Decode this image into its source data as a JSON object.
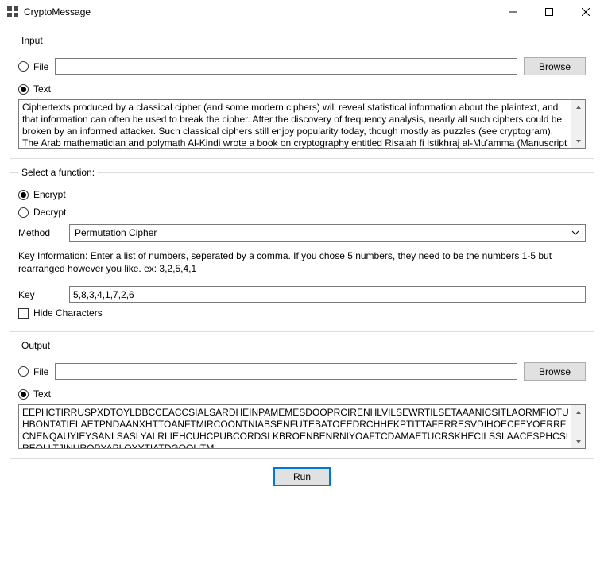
{
  "window": {
    "title": "CryptoMessage"
  },
  "input": {
    "legend": "Input",
    "file_label": "File",
    "file_value": "",
    "browse_label": "Browse",
    "text_label": "Text",
    "text_value": "Ciphertexts produced by a classical cipher (and some modern ciphers) will reveal statistical information about the plaintext, and that information can often be used to break the cipher. After the discovery of frequency analysis, nearly all such ciphers could be broken by an informed attacker. Such classical ciphers still enjoy popularity today, though mostly as puzzles (see cryptogram). The Arab mathematician and polymath Al-Kindi wrote a book on cryptography entitled Risalah fi Istikhraj al-Mu'amma (Manuscript for"
  },
  "func": {
    "legend": "Select a function:",
    "encrypt_label": "Encrypt",
    "decrypt_label": "Decrypt",
    "method_label": "Method",
    "method_value": "Permutation Cipher",
    "key_info": "Key Information: Enter a list of numbers, seperated by a comma. If you chose 5 numbers, they need to be the numbers 1-5 but rearranged however you like. ex: 3,2,5,4,1",
    "key_label": "Key",
    "key_value": "5,8,3,4,1,7,2,6",
    "hide_label": "Hide Characters"
  },
  "output": {
    "legend": "Output",
    "file_label": "File",
    "file_value": "",
    "browse_label": "Browse",
    "text_label": "Text",
    "text_value": "EEPHCTIRRUSPXDTOYLDBCCEACCSIALSARDHEINPAMEMESDOOPRCIRENHLVILSEWRTILSETAAANICSITLAORMFIOTUHBONTATIELAETPNDAANXHTTOANFTMIRCOONTNIABSENFUTEBATOEEDRCHHEKPTITTAFERRESVDIHOECFEYOERRFCNENQAUYIEYSANLSASLYALRLIEHCUHCPUBCORDSLKBROENBENRNIYOAFTCDAMAETUCRSKHECILSSLAACESPHCSIREOLLTJINUROPYAPLOYYTIATDGOOUTM"
  },
  "run_label": "Run"
}
